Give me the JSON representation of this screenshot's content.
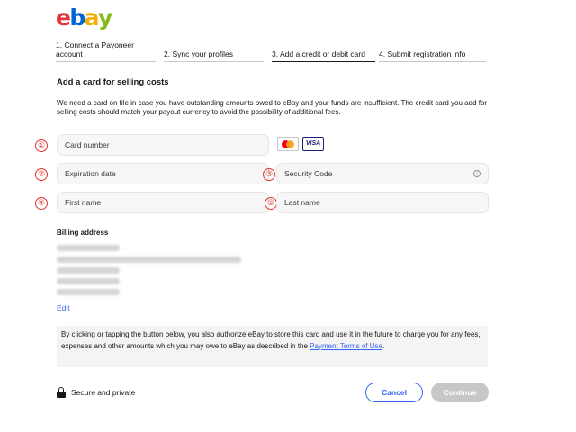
{
  "logo": {
    "l1": "e",
    "l2": "b",
    "l3": "a",
    "l4": "y"
  },
  "steps": [
    {
      "label": "1. Connect a Payoneer account",
      "active": false
    },
    {
      "label": "2. Sync your profiles",
      "active": false
    },
    {
      "label": "3. Add a credit or debit card",
      "active": true
    },
    {
      "label": "4. Submit registration info",
      "active": false
    }
  ],
  "section_title": "Add a card for selling costs",
  "description": "We need a card on file in case you have outstanding amounts owed to eBay and your funds are insufficient. The credit card you add for selling costs should match your payout currency to avoid the possibility of additional fees.",
  "markers": [
    "①",
    "②",
    "③",
    "④",
    "⑤"
  ],
  "fields": {
    "card_number": "Card number",
    "expiration_date": "Expiration date",
    "security_code": "Security Code",
    "first_name": "First name",
    "last_name": "Last name"
  },
  "card_brands": {
    "visa": "VISA",
    "mastercard_icon": "mastercard-icon"
  },
  "billing": {
    "title": "Billing address",
    "edit": "Edit"
  },
  "consent": {
    "text": "By clicking or tapping the button below, you also authorize eBay to store this card and use it in the future to charge you for any fees, expenses and other amounts which you may owe to eBay as described in the",
    "link": "Payment Terms of Use",
    "end": "."
  },
  "secure": {
    "label": "Secure and private",
    "icon": "lock-icon"
  },
  "buttons": {
    "cancel": "Cancel",
    "continue": "Continue"
  },
  "colors": {
    "link": "#3665f3",
    "marker": "#e0332b",
    "disabled_button": "#c7c7c7",
    "logo_e": "#e53238",
    "logo_b": "#0064d2",
    "logo_a": "#f5af02",
    "logo_y": "#86b817"
  }
}
